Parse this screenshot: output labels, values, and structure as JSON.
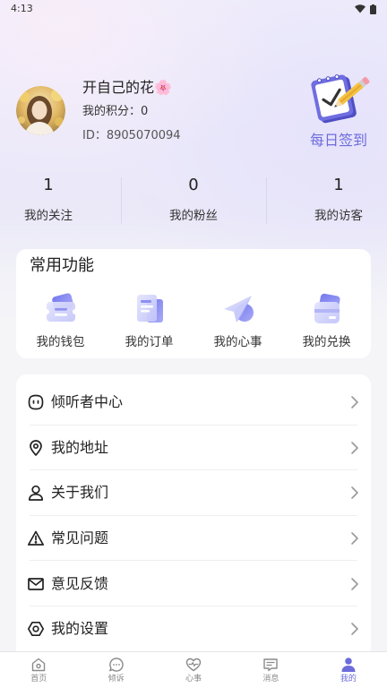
{
  "status_bar": {
    "time": "4:13",
    "icons": [
      "wifi-icon",
      "battery-icon"
    ]
  },
  "profile": {
    "avatar": "user-avatar-photo",
    "nickname": "开自己的花🌸",
    "points_text": "我的积分：0",
    "id_text": "ID：8905070094"
  },
  "checkin": {
    "icon": "checkin-notepad-pencil-icon",
    "label": "每日签到"
  },
  "stats": [
    {
      "value": "1",
      "label": "我的关注"
    },
    {
      "value": "0",
      "label": "我的粉丝"
    },
    {
      "value": "1",
      "label": "我的访客"
    }
  ],
  "common_functions": {
    "title": "常用功能",
    "items": [
      {
        "icon": "wallet-icon",
        "label": "我的钱包"
      },
      {
        "icon": "order-document-icon",
        "label": "我的订单"
      },
      {
        "icon": "paper-plane-icon",
        "label": "我的心事"
      },
      {
        "icon": "exchange-card-icon",
        "label": "我的兑换"
      }
    ]
  },
  "menu": {
    "chevron_icon": "chevron-right-icon",
    "items": [
      {
        "icon": "listener-face-icon",
        "label": "倾听者中心"
      },
      {
        "icon": "location-pin-icon",
        "label": "我的地址"
      },
      {
        "icon": "person-icon",
        "label": "关于我们"
      },
      {
        "icon": "warning-icon",
        "label": "常见问题"
      },
      {
        "icon": "mail-icon",
        "label": "意见反馈"
      },
      {
        "icon": "settings-hexagon-icon",
        "label": "我的设置"
      }
    ]
  },
  "tab_bar": {
    "items": [
      {
        "icon": "home-icon",
        "label": "首页",
        "active": false
      },
      {
        "icon": "chat-bubble-icon",
        "label": "倾诉",
        "active": false
      },
      {
        "icon": "heart-pulse-icon",
        "label": "心事",
        "active": false
      },
      {
        "icon": "message-icon",
        "label": "消息",
        "active": false
      },
      {
        "icon": "profile-icon",
        "label": "我的",
        "active": true
      }
    ]
  },
  "colors": {
    "accent": "#6d6cdb",
    "background_top": "#eceafb",
    "background": "#f5f5f8",
    "card": "#ffffff",
    "text_primary": "#222222",
    "tab_inactive": "#8a8a8a"
  }
}
